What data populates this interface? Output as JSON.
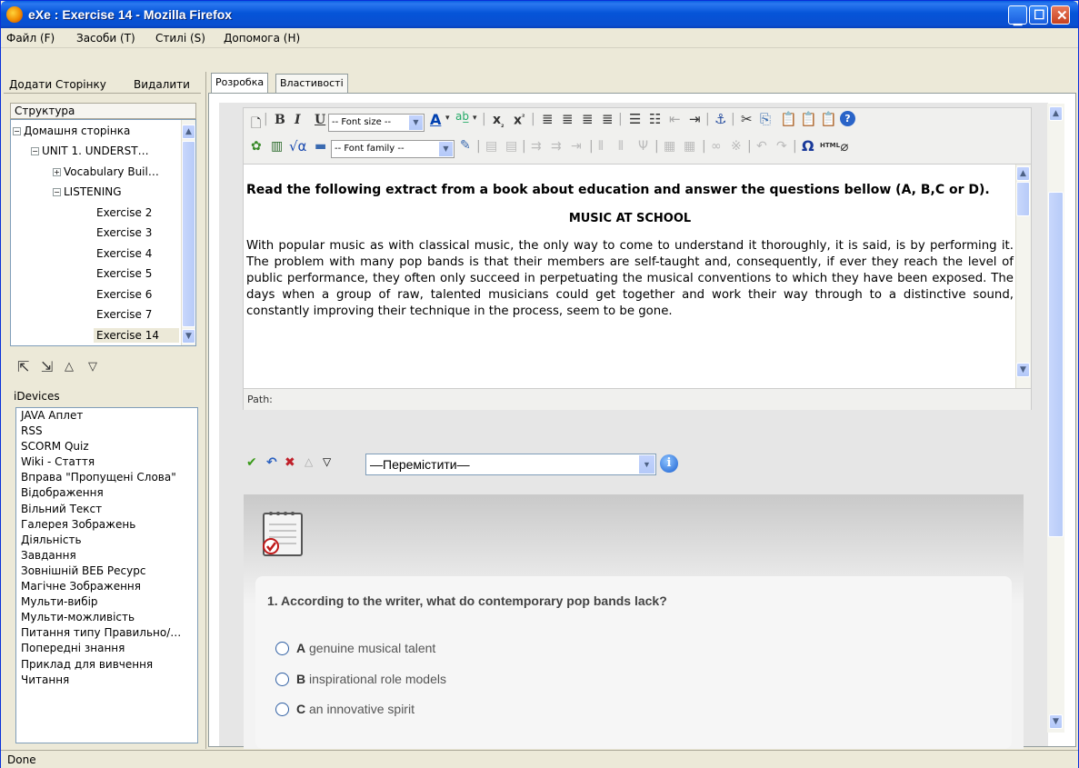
{
  "window": {
    "title": "eXe : Exercise 14 - Mozilla Firefox"
  },
  "menu": [
    {
      "label": "Файл (F)"
    },
    {
      "label": "Засоби (T)"
    },
    {
      "label": "Стилі (S)"
    },
    {
      "label": "Допомога (H)"
    }
  ],
  "left_panel": {
    "add_page": "Додати Сторінку",
    "delete": "Видалити",
    "structure_header": "Структура",
    "tree": [
      {
        "label": "Домашня сторінка",
        "toggle": "−"
      },
      {
        "label": "UNIT 1. UNDERST…",
        "toggle": "−"
      },
      {
        "label": "Vocabulary Buil…",
        "toggle": "+"
      },
      {
        "label": "LISTENING",
        "toggle": "−"
      },
      {
        "label": "Exercise 2"
      },
      {
        "label": "Exercise 3"
      },
      {
        "label": "Exercise 4"
      },
      {
        "label": "Exercise 5"
      },
      {
        "label": "Exercise 6"
      },
      {
        "label": "Exercise 7"
      },
      {
        "label": "Exercise 14",
        "selected": true
      }
    ],
    "move_icons": [
      "promote-icon",
      "demote-icon",
      "move-up-icon",
      "move-down-icon"
    ],
    "idevices_header": "iDevices",
    "idevices": [
      "JAVA Аплет",
      "RSS",
      "SCORM Quiz",
      "Wiki - Стаття",
      "Вправа \"Пропущені Слова\"",
      "Відображення",
      "Вільний Текст",
      "Галерея Зображень",
      "Діяльність",
      "Завдання",
      "Зовнішній ВЕБ Ресурс",
      "Магічне Зображення",
      "Мульти-вибір",
      "Мульти-можливість",
      "Питання типу Правильно/…",
      "Попередні знання",
      "Приклад для вивчення",
      "Читання"
    ]
  },
  "tabs": [
    {
      "label": "Розробка",
      "active": true
    },
    {
      "label": "Властивості",
      "active": false
    }
  ],
  "editor": {
    "font_size_select": "-- Font size --",
    "font_family_select": "-- Font family --",
    "question_heading": "Read the following extract from a book about education and answer the questions bellow (A, B,C or D).",
    "title": "MUSIC AT SCHOOL",
    "body": "With popular music as with classical music, the only way to come to understand it thoroughly, it is said, is by performing it. The problem with many pop bands is that their members are self-taught and, consequently, if ever they reach the level of public performance, they often only succeed in perpetuating the musical conventions to which they have been exposed. The days when a group of raw, talented musicians could get together and work their way through to a distinctive sound, constantly improving their technique in the process, seem to be gone.",
    "path_label": "Path:"
  },
  "idevice_controls": {
    "move_select": "—Перемістити—"
  },
  "quiz": {
    "question": "1. According to the writer, what do contemporary pop bands lack?",
    "options": [
      {
        "letter": "A",
        "text": "genuine musical talent"
      },
      {
        "letter": "B",
        "text": "inspirational role models"
      },
      {
        "letter": "C",
        "text": "an innovative spirit"
      }
    ]
  },
  "status": {
    "text": "Done"
  },
  "colors": {
    "titlebar": "#0a54d8",
    "accent": "#316ac5",
    "quiz_bg": "#f6f6f6"
  }
}
